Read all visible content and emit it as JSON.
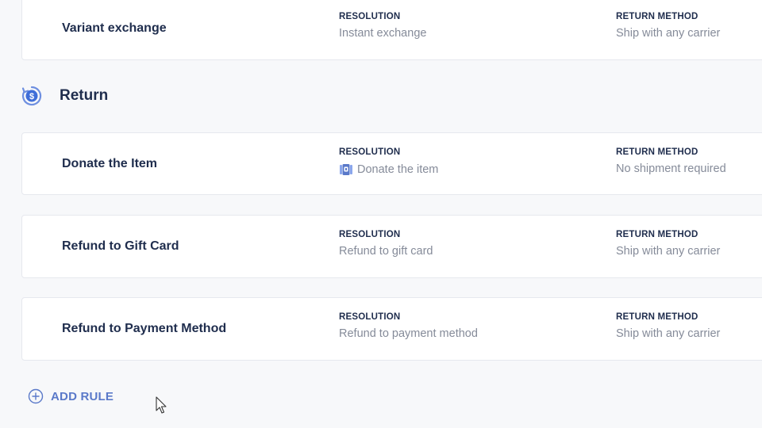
{
  "top_card": {
    "name": "Variant exchange",
    "resolution_label": "RESOLUTION",
    "resolution_value": "Instant exchange",
    "return_method_label": "RETURN METHOD",
    "return_method_value": "Ship with any carrier"
  },
  "section": {
    "title": "Return",
    "icon": "dollar-refresh-icon",
    "rules": [
      {
        "name": "Donate the Item",
        "resolution_label": "RESOLUTION",
        "resolution_value": "Donate the item",
        "resolution_icon": "donate-box-icon",
        "return_method_label": "RETURN METHOD",
        "return_method_value": "No shipment required"
      },
      {
        "name": "Refund to Gift Card",
        "resolution_label": "RESOLUTION",
        "resolution_value": "Refund to gift card",
        "return_method_label": "RETURN METHOD",
        "return_method_value": "Ship with any carrier"
      },
      {
        "name": "Refund to Payment Method",
        "resolution_label": "RESOLUTION",
        "resolution_value": "Refund to payment method",
        "return_method_label": "RETURN METHOD",
        "return_method_value": "Ship with any carrier"
      }
    ]
  },
  "add_rule": {
    "label": "ADD RULE",
    "icon": "plus-circle-icon"
  },
  "colors": {
    "accent": "#5a79c9",
    "heading": "#1f2d4d",
    "muted_text": "#858b99",
    "card_border": "#e6e8ee",
    "background": "#f7f8fa"
  }
}
